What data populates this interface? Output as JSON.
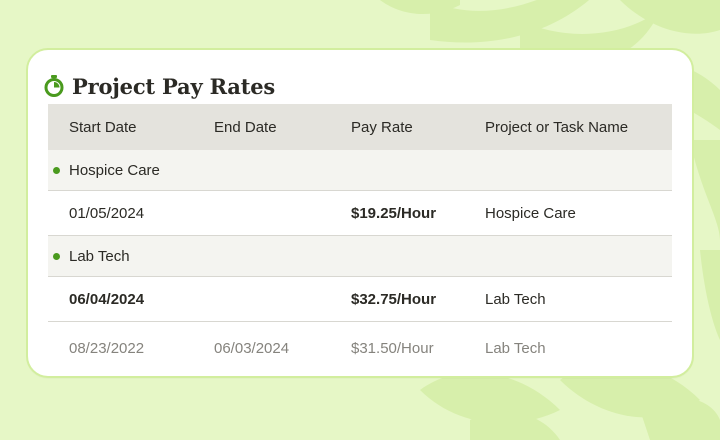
{
  "card": {
    "title": "Project Pay Rates",
    "icon": "stopwatch-icon",
    "accent_color": "#4a9a1e"
  },
  "table": {
    "columns": [
      "Start Date",
      "End Date",
      "Pay Rate",
      "Project or Task Name"
    ],
    "groups": [
      {
        "name": "Hospice Care",
        "rows": [
          {
            "start": "01/05/2024",
            "end": "",
            "rate": "$19.25/Hour",
            "name": "Hospice Care"
          }
        ]
      },
      {
        "name": "Lab Tech",
        "rows": [
          {
            "start": "06/04/2024",
            "end": "",
            "rate": "$32.75/Hour",
            "name": "Lab Tech"
          },
          {
            "start": "08/23/2022",
            "end": "06/03/2024",
            "rate": "$31.50/Hour",
            "name": "Lab Tech"
          }
        ]
      }
    ]
  }
}
